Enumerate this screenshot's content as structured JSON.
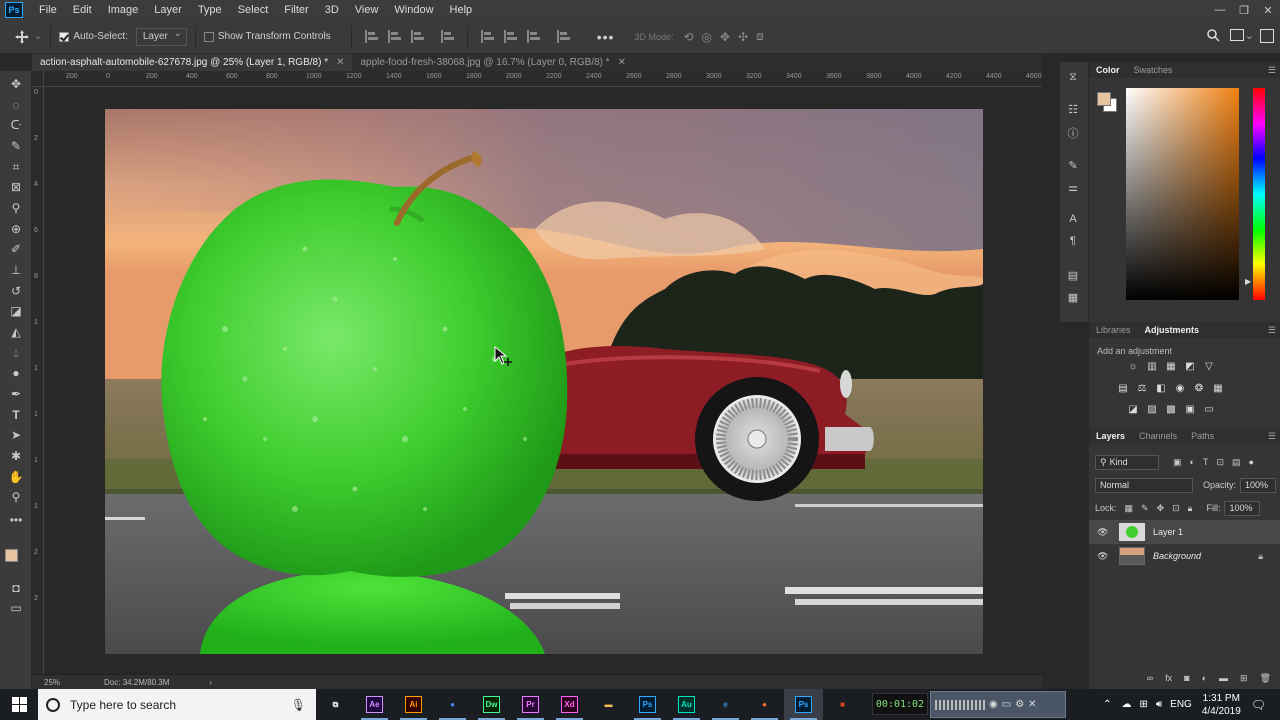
{
  "menubar": {
    "app_icon": "Ps",
    "items": [
      "File",
      "Edit",
      "Image",
      "Layer",
      "Type",
      "Select",
      "Filter",
      "3D",
      "View",
      "Window",
      "Help"
    ]
  },
  "window_controls": {
    "minimize": "—",
    "restore": "❐",
    "close": "✕"
  },
  "options_bar": {
    "auto_select_label": "Auto-Select:",
    "auto_select_checked": true,
    "auto_select_target": "Layer",
    "show_transform_label": "Show Transform Controls",
    "show_transform_checked": false,
    "mode_3d_label": "3D Mode:",
    "more_label": "•••"
  },
  "tabs": [
    {
      "label": "action-asphalt-automobile-627678.jpg @ 25% (Layer 1, RGB/8) *",
      "active": true
    },
    {
      "label": "apple-food-fresh-38068.jpg @ 16.7% (Layer 0, RGB/8) *",
      "active": false
    }
  ],
  "rulers": {
    "horizontal": [
      "200",
      "0",
      "200",
      "400",
      "600",
      "800",
      "1000",
      "1200",
      "1400",
      "1600",
      "1800",
      "2000",
      "2200",
      "2400",
      "2600",
      "2800",
      "3000",
      "3200",
      "3400",
      "3600",
      "3800",
      "4000",
      "4200",
      "4400",
      "4600"
    ],
    "vertical": [
      "0",
      "2",
      "4",
      "6",
      "8",
      "1",
      "1",
      "1",
      "1",
      "1",
      "2",
      "2"
    ]
  },
  "status_bar": {
    "zoom": "25%",
    "doc_info": "Doc: 34.2M/80.3M",
    "arrow": "›"
  },
  "color_panel": {
    "tabs": [
      "Color",
      "Swatches"
    ],
    "active_tab": "Color",
    "foreground": "#e9c3a1",
    "background": "#ffffff",
    "base_hue": "#f08010"
  },
  "adjustments_panel": {
    "tabs": [
      "Libraries",
      "Adjustments"
    ],
    "active_tab": "Adjustments",
    "add_label": "Add an adjustment"
  },
  "layers_panel": {
    "tabs": [
      "Layers",
      "Channels",
      "Paths"
    ],
    "active_tab": "Layers",
    "filter_kind": "Kind",
    "blend_mode": "Normal",
    "opacity_label": "Opacity:",
    "opacity_value": "100%",
    "lock_label": "Lock:",
    "fill_label": "Fill:",
    "fill_value": "100%",
    "layers": [
      {
        "name": "Layer 1",
        "visible": true,
        "selected": true,
        "locked": false
      },
      {
        "name": "Background",
        "visible": true,
        "selected": false,
        "locked": true
      }
    ]
  },
  "taskbar": {
    "search_placeholder": "Type here to search",
    "apps": [
      {
        "name": "Task View",
        "label": "⧉",
        "color": "#ffffff",
        "bg": "transparent"
      },
      {
        "name": "After Effects",
        "label": "Ae",
        "color": "#d291ff",
        "bg": "#1f0740"
      },
      {
        "name": "Illustrator",
        "label": "Ai",
        "color": "#ff9a00",
        "bg": "#330000"
      },
      {
        "name": "Chrome",
        "label": "●",
        "color": "#4285f4",
        "bg": "transparent"
      },
      {
        "name": "Dreamweaver",
        "label": "Dw",
        "color": "#46f49a",
        "bg": "#072401"
      },
      {
        "name": "Premiere",
        "label": "Pr",
        "color": "#ea77ff",
        "bg": "#2a0634"
      },
      {
        "name": "XD",
        "label": "Xd",
        "color": "#ff61f6",
        "bg": "#2e001e"
      },
      {
        "name": "File Explorer",
        "label": "▬",
        "color": "#f5c44e",
        "bg": "transparent"
      },
      {
        "name": "Photoshop",
        "label": "Ps",
        "color": "#31a8ff",
        "bg": "#001d34"
      },
      {
        "name": "Audition",
        "label": "Au",
        "color": "#00e4bb",
        "bg": "#00302a"
      },
      {
        "name": "Edge",
        "label": "e",
        "color": "#3b8fe0",
        "bg": "transparent"
      },
      {
        "name": "Firefox",
        "label": "●",
        "color": "#ff7139",
        "bg": "transparent"
      },
      {
        "name": "Photoshop",
        "label": "Ps",
        "color": "#31a8ff",
        "bg": "#001d34"
      },
      {
        "name": "Recorder",
        "label": "■",
        "color": "#e8441a",
        "bg": "transparent"
      }
    ],
    "recorder_timer": "00:01:02",
    "language": "ENG",
    "time": "1:31 PM",
    "date": "4/4/2019"
  }
}
